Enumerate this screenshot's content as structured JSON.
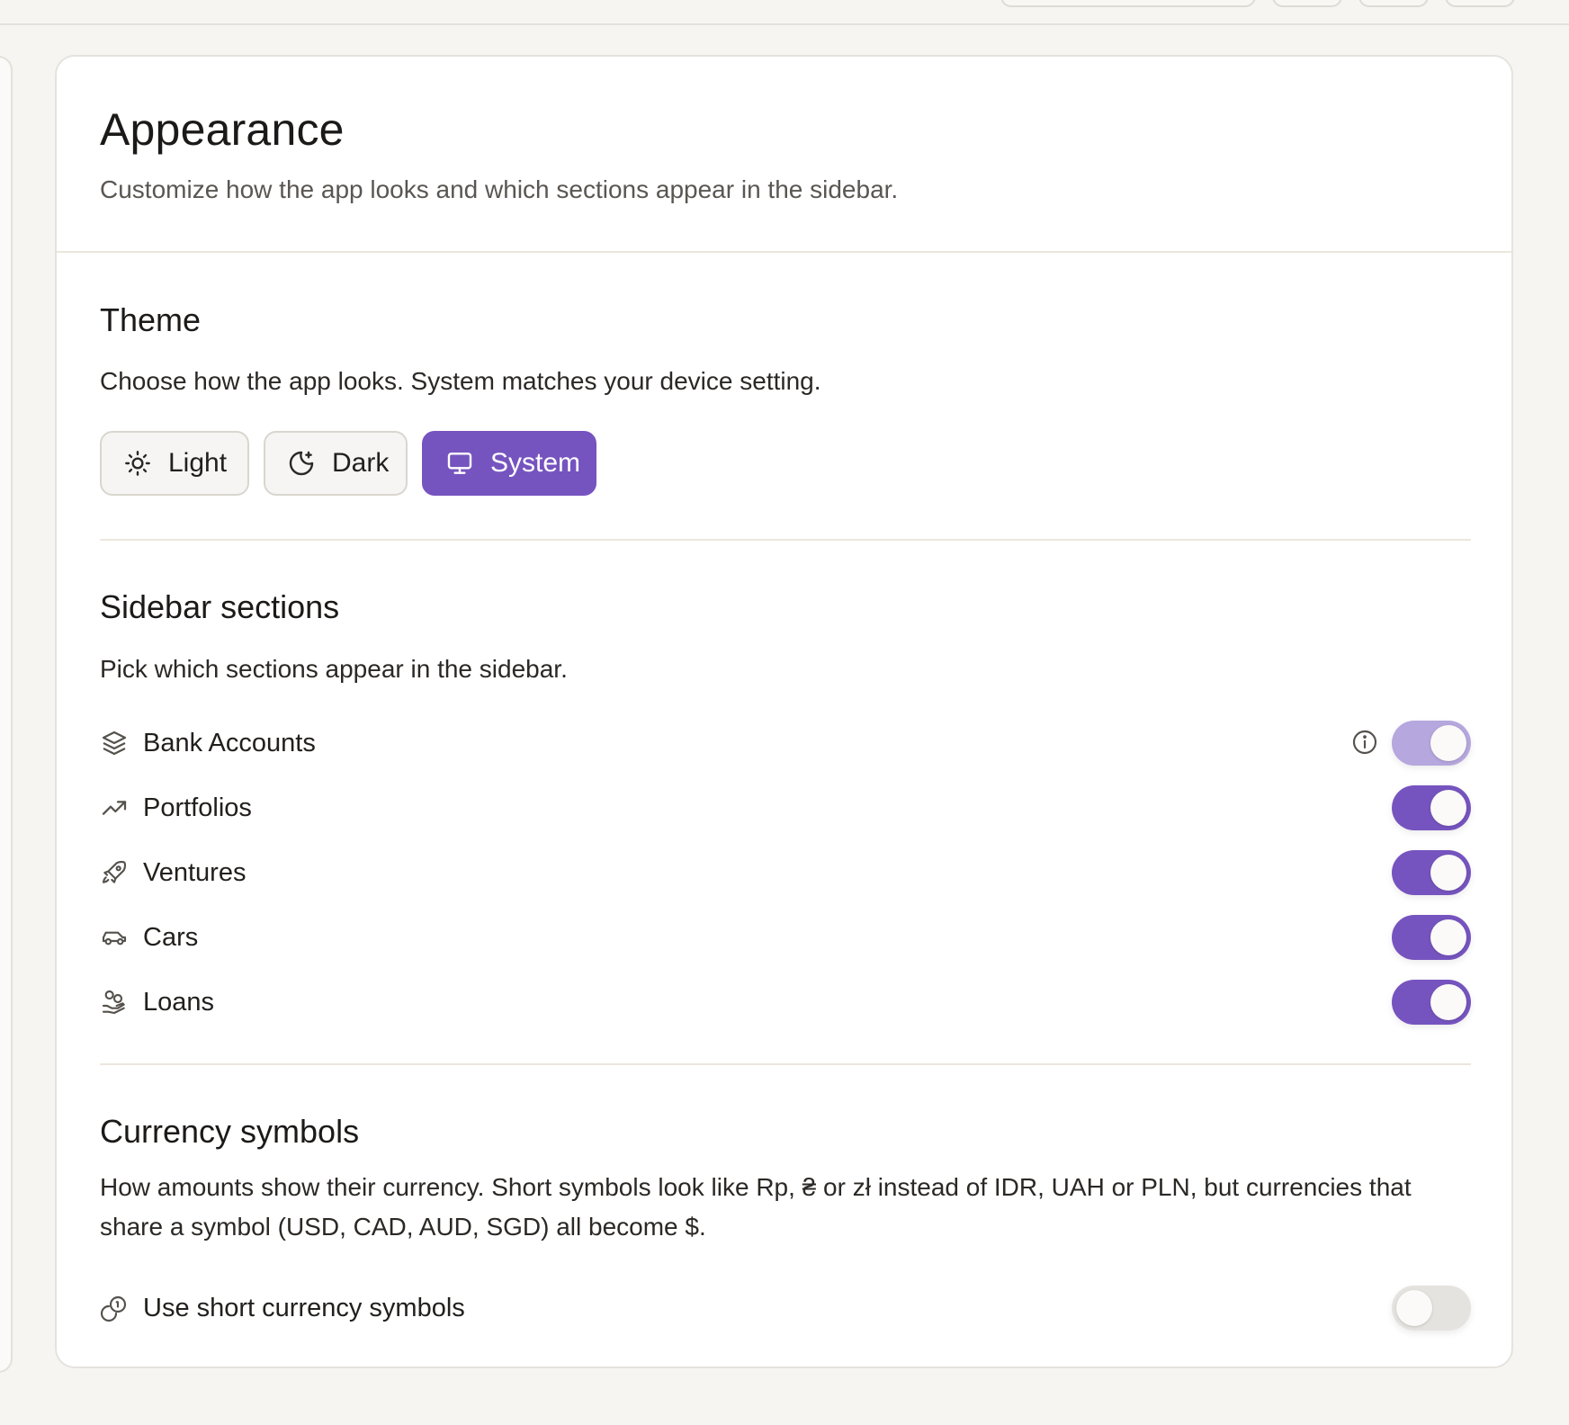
{
  "header": {
    "title": "Appearance",
    "subtitle": "Customize how the app looks and which sections appear in the sidebar."
  },
  "theme": {
    "title": "Theme",
    "description": "Choose how the app looks. System matches your device setting.",
    "options": [
      {
        "label": "Light",
        "icon": "sun-icon",
        "selected": false
      },
      {
        "label": "Dark",
        "icon": "moon-icon",
        "selected": false
      },
      {
        "label": "System",
        "icon": "monitor-icon",
        "selected": true
      }
    ]
  },
  "sidebar_sections": {
    "title": "Sidebar sections",
    "description": "Pick which sections appear in the sidebar.",
    "items": [
      {
        "label": "Bank Accounts",
        "icon": "layers-icon",
        "enabled": true,
        "locked": true,
        "has_info": true
      },
      {
        "label": "Portfolios",
        "icon": "trending-up-icon",
        "enabled": true
      },
      {
        "label": "Ventures",
        "icon": "rocket-icon",
        "enabled": true
      },
      {
        "label": "Cars",
        "icon": "car-icon",
        "enabled": true
      },
      {
        "label": "Loans",
        "icon": "hand-coins-icon",
        "enabled": true
      }
    ]
  },
  "currency": {
    "title": "Currency symbols",
    "description_line1": "How amounts show their currency. Short symbols look like Rp, ₴ or zł instead of IDR, UAH or PLN, but currencies that",
    "description_line2": "share a symbol (USD, CAD, AUD, SGD) all become $.",
    "option_label": "Use short currency symbols",
    "option_icon": "coins-icon",
    "enabled": false
  },
  "colors": {
    "accent": "#7654bf",
    "accent_disabled": "#b6a7de",
    "toggle_off": "#e5e3df",
    "background": "#f6f5f2",
    "card": "#ffffff"
  }
}
